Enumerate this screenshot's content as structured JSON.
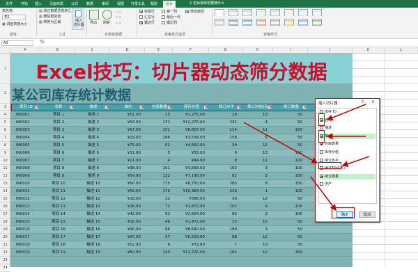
{
  "tabs": [
    "文件",
    "开始",
    "插入",
    "页面布局",
    "公式",
    "数据",
    "审阅",
    "视图",
    "开发工具",
    "帮助",
    "设计"
  ],
  "active_tab_index": 10,
  "tellme": "告诉我你想要做什么",
  "ribbon": {
    "table_name_label": "表名称:",
    "table_name_value": "表1",
    "resize_label": "调整表格大小",
    "group_properties": "属性",
    "pivot_summary": "通过数据透视表汇总",
    "remove_dup": "删除重复值",
    "convert_range": "转换为区域",
    "insert_slicer": "插入\n切片器",
    "export": "导出",
    "refresh": "刷新",
    "group_tools": "工具",
    "group_external": "外部表数据",
    "opt_header": "标题行",
    "opt_total": "汇总行",
    "opt_banded_rows": "镶边行",
    "opt_first_col": "第一列",
    "opt_last_col": "最后一列",
    "opt_banded_cols": "镶边列",
    "opt_filter_btn": "筛选按钮",
    "group_style_opts": "表格样式选项",
    "group_styles": "表格样式"
  },
  "namebox": "A3",
  "fx": "fx",
  "columns": [
    "A",
    "B",
    "C",
    "D",
    "E",
    "F",
    "G",
    "H",
    "I",
    "J",
    "K",
    "L"
  ],
  "rows": [
    "1",
    "2",
    "3",
    "4",
    "5",
    "6",
    "7",
    "8",
    "9",
    "10",
    "11",
    "12",
    "13",
    "14",
    "15",
    "16",
    "17",
    "18",
    "19",
    "20",
    "21",
    "22",
    "23",
    "24"
  ],
  "banner": "Excel技巧：切片器动态筛分数据",
  "sheet_title": "某公司库存统计数据",
  "headers": [
    "库存 ID",
    "名称",
    "描述",
    "单价",
    "在库数量",
    "库存价值",
    "续订水平",
    "续订时间(天)",
    "续订数量"
  ],
  "table": [
    [
      "IN0001",
      "项目 1",
      "描述 1",
      "¥51.00",
      "25",
      "¥1,275.00",
      "29",
      "13",
      "50"
    ],
    [
      "IN0002",
      "项目 2",
      "描述 2",
      "¥93.00",
      "132",
      "¥12,276.00",
      "231",
      "4",
      "50"
    ],
    [
      "IN0003",
      "项目 3",
      "描述 3",
      "¥57.00",
      "151",
      "¥8,607.00",
      "114",
      "11",
      "150"
    ],
    [
      "IN0004",
      "项目 4",
      "描述 4",
      "¥19.00",
      "186",
      "¥3,534.00",
      "158",
      "6",
      "50"
    ],
    [
      "IN0005",
      "项目 5",
      "描述 5",
      "¥75.00",
      "62",
      "¥4,650.00",
      "39",
      "12",
      "50"
    ],
    [
      "IN0006",
      "项目 6",
      "描述 6",
      "¥11.00",
      "5",
      "¥55.00",
      "9",
      "13",
      "150"
    ],
    [
      "IN0007",
      "项目 7",
      "描述 7",
      "¥11.00",
      "4",
      "¥44.00",
      "8",
      "11",
      "120"
    ],
    [
      "IN0008",
      "项目 8",
      "描述 8",
      "¥38.00",
      "101",
      "¥3,838.00",
      "162",
      "3",
      "100"
    ],
    [
      "IN0009",
      "项目 9",
      "描述 9",
      "¥59.00",
      "122",
      "¥7,198.00",
      "82",
      "3",
      "150"
    ],
    [
      "IN0010",
      "项目 10",
      "描述 10",
      "¥50.00",
      "175",
      "¥8,750.00",
      "283",
      "8",
      "150"
    ],
    [
      "IN0011",
      "项目 11",
      "描述 11",
      "¥59.00",
      "176",
      "¥10,384.00",
      "229",
      "1",
      "100"
    ],
    [
      "IN0012",
      "项目 12",
      "描述 12",
      "¥18.00",
      "22",
      "¥396.00",
      "36",
      "12",
      "50"
    ],
    [
      "IN0013",
      "项目 13",
      "描述 13",
      "¥26.00",
      "72",
      "¥1,872.00",
      "102",
      "9",
      "100"
    ],
    [
      "IN0014",
      "项目 14",
      "描述 14",
      "¥42.00",
      "62",
      "¥2,604.00",
      "83",
      "2",
      "100"
    ],
    [
      "IN0015",
      "项目 15",
      "描述 15",
      "¥32.00",
      "46",
      "¥1,472.00",
      "23",
      "15",
      "50"
    ],
    [
      "IN0016",
      "项目 16",
      "描述 16",
      "¥90.00",
      "96",
      "¥8,640.00",
      "180",
      "3",
      "50"
    ],
    [
      "IN0017",
      "项目 17",
      "描述 17",
      "¥97.00",
      "57",
      "¥5,529.00",
      "98",
      "12",
      "50"
    ],
    [
      "IN0018",
      "项目 18",
      "描述 18",
      "¥12.00",
      "6",
      "¥72.00",
      "7",
      "13",
      "50"
    ],
    [
      "IN0019",
      "项目 19",
      "描述 19",
      "¥82.00",
      "143",
      "¥11,726.00",
      "164",
      "12",
      "150"
    ]
  ],
  "dialog": {
    "title": "插入切片器",
    "help": "?",
    "close": "×",
    "items": [
      {
        "label": "库存 ID",
        "checked": false
      },
      {
        "label": "名称",
        "checked": true
      },
      {
        "label": "描述",
        "checked": false
      },
      {
        "label": "单价",
        "checked": true
      },
      {
        "label": "在库数量",
        "checked": true
      },
      {
        "label": "库存价值",
        "checked": false
      },
      {
        "label": "续订水平",
        "checked": false
      },
      {
        "label": "续订时间(天)",
        "checked": false
      },
      {
        "label": "续订数量",
        "checked": true
      },
      {
        "label": "停产",
        "checked": false
      }
    ],
    "ok": "确定",
    "cancel": "取消"
  },
  "colors": {
    "excel_green": "#217346",
    "banner_bg": "#8ad1d6",
    "banner_text": "#c8102e",
    "table_header": "#46a2b0",
    "table_body": "#7fb3b3",
    "table_band": "#8dbcbc",
    "annotation_red": "#c00000"
  }
}
